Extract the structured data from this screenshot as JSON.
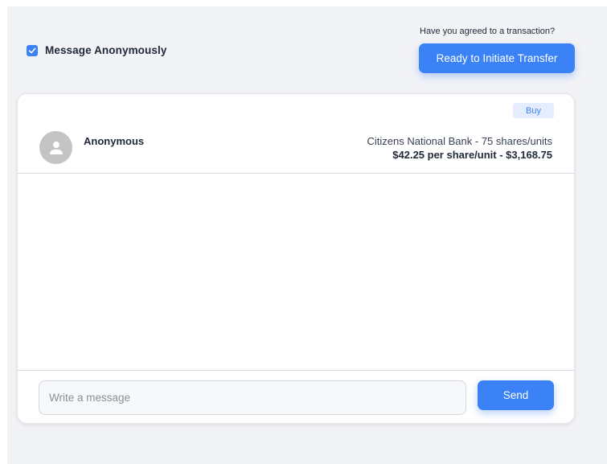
{
  "header": {
    "anonymous_checkbox": {
      "label": "Message Anonymously",
      "checked": true,
      "icon": "checkmark-icon"
    },
    "agreed_prompt": "Have you agreed to a transaction?",
    "initiate_button_label": "Ready to Initiate Transfer"
  },
  "chat": {
    "badge": "Buy",
    "sender": {
      "name": "Anonymous",
      "avatar_icon": "user-icon"
    },
    "listing": {
      "line1": "Citizens National Bank - 75 shares/units",
      "line2": "$42.25 per share/unit - $3,168.75"
    },
    "composer": {
      "placeholder": "Write a message",
      "value": "",
      "send_label": "Send"
    }
  },
  "colors": {
    "accent": "#3b82f6",
    "badge_bg": "#e3edfd",
    "page_bg": "#f2f3f6",
    "avatar_bg": "#c4c4c4"
  }
}
